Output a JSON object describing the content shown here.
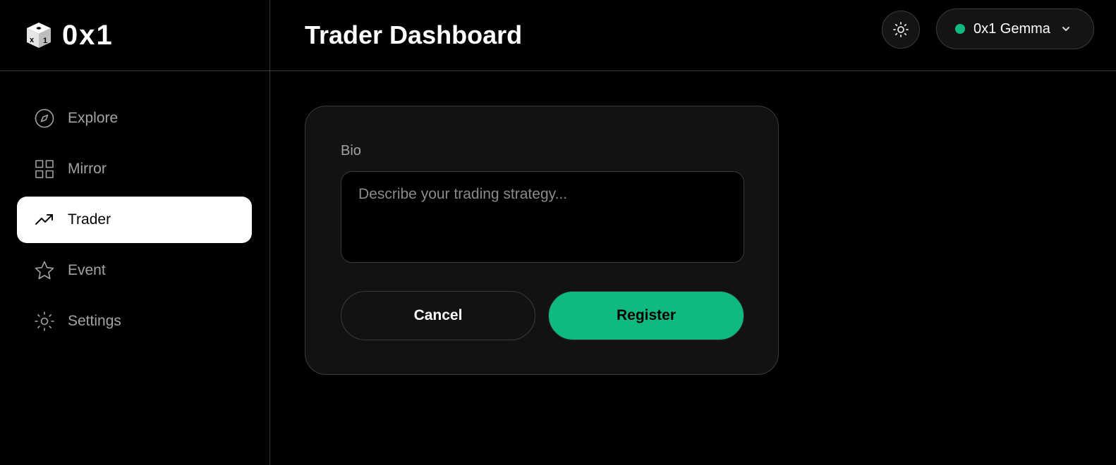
{
  "app": {
    "logo_text": "0x1"
  },
  "header": {
    "title": "Trader Dashboard",
    "theme_toggle_icon": "sun-icon",
    "wallet": {
      "name": "0x1 Gemma",
      "status_color": "#10b981"
    }
  },
  "sidebar": {
    "items": [
      {
        "label": "Explore",
        "icon": "compass-icon",
        "active": false
      },
      {
        "label": "Mirror",
        "icon": "grid-icon",
        "active": false
      },
      {
        "label": "Trader",
        "icon": "trending-up-icon",
        "active": true
      },
      {
        "label": "Event",
        "icon": "star-icon",
        "active": false
      },
      {
        "label": "Settings",
        "icon": "gear-icon",
        "active": false
      }
    ]
  },
  "form": {
    "bio_label": "Bio",
    "bio_value": "",
    "bio_placeholder": "Describe your trading strategy...",
    "cancel_label": "Cancel",
    "register_label": "Register"
  },
  "colors": {
    "accent": "#10b981",
    "background": "#000000",
    "card": "#121212",
    "border": "#3a3a3a"
  }
}
